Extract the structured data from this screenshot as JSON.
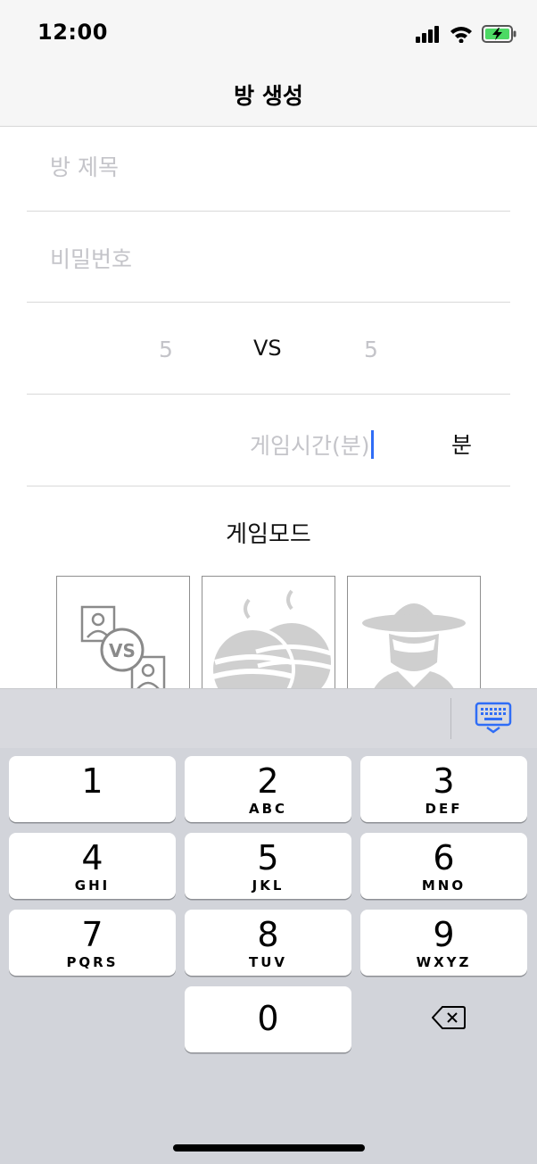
{
  "status_bar": {
    "time": "12:00"
  },
  "nav": {
    "title": "방 생성"
  },
  "form": {
    "room_title_placeholder": "방 제목",
    "password_placeholder": "비밀번호",
    "team_left_placeholder": "5",
    "vs_label": "VS",
    "team_right_placeholder": "5",
    "game_time_placeholder": "게임시간(분)",
    "minute_unit": "분"
  },
  "game_mode": {
    "title": "게임모드",
    "tiles": [
      {
        "icon": "vs-match-icon",
        "badge": "VS"
      },
      {
        "icon": "bombs-icon"
      },
      {
        "icon": "spy-icon"
      }
    ]
  },
  "keyboard": {
    "keys": [
      {
        "digit": "1",
        "letters": ""
      },
      {
        "digit": "2",
        "letters": "ABC"
      },
      {
        "digit": "3",
        "letters": "DEF"
      },
      {
        "digit": "4",
        "letters": "GHI"
      },
      {
        "digit": "5",
        "letters": "JKL"
      },
      {
        "digit": "6",
        "letters": "MNO"
      },
      {
        "digit": "7",
        "letters": "PQRS"
      },
      {
        "digit": "8",
        "letters": "TUV"
      },
      {
        "digit": "9",
        "letters": "WXYZ"
      },
      {
        "digit": "0",
        "letters": ""
      }
    ],
    "accent_color": "#2f6df6"
  }
}
